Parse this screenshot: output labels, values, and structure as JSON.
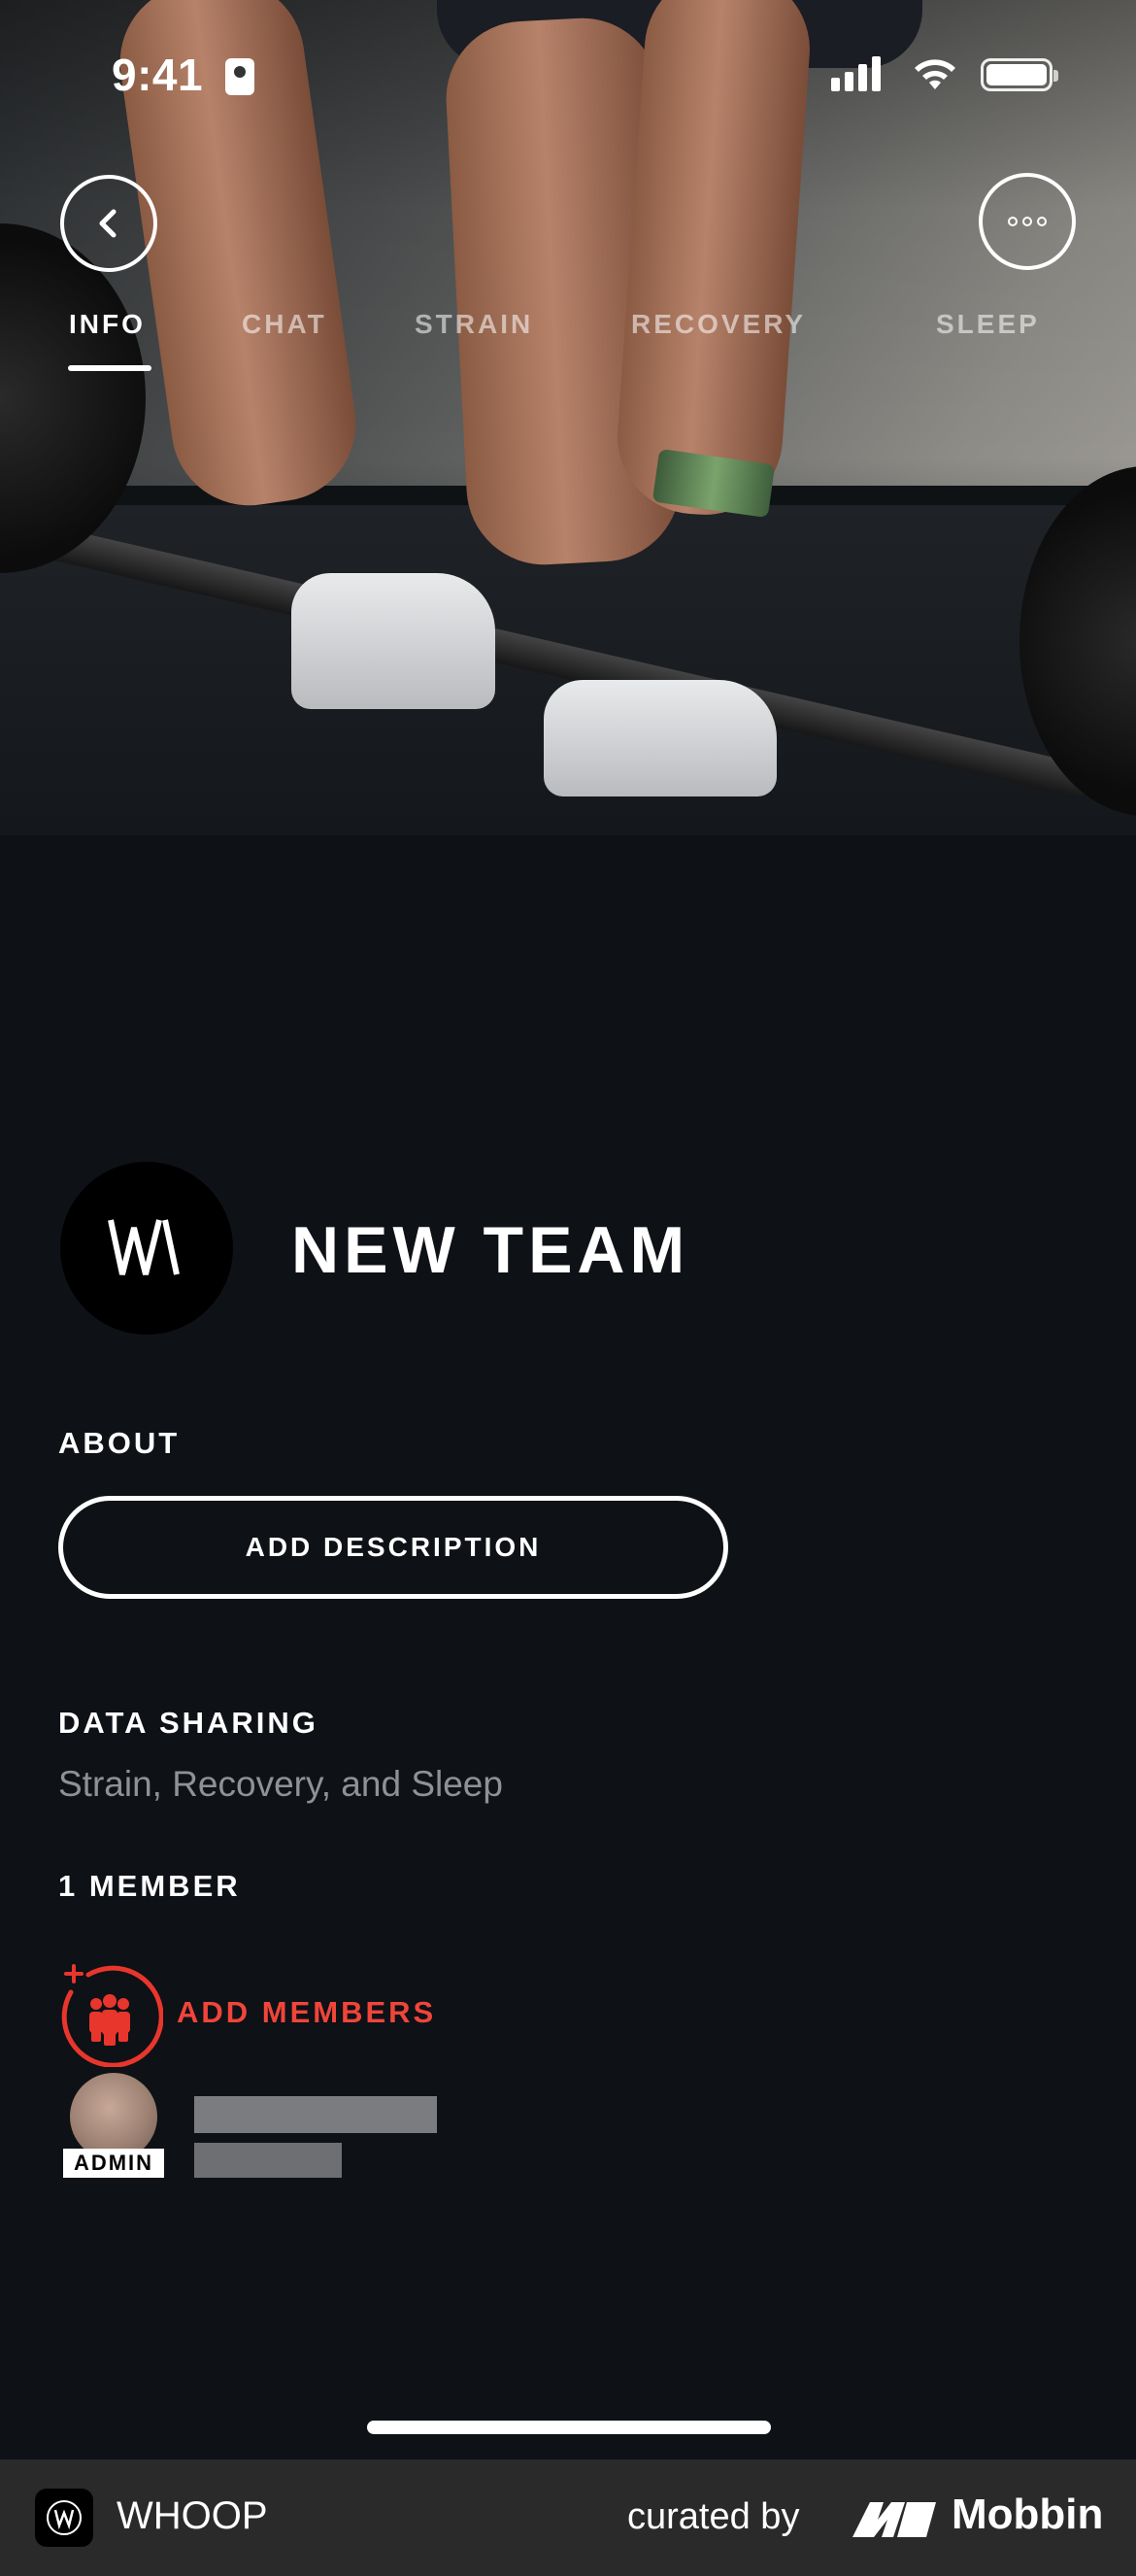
{
  "status_bar": {
    "time": "9:41"
  },
  "tabs": [
    {
      "label": "INFO",
      "active": true
    },
    {
      "label": "CHAT",
      "active": false
    },
    {
      "label": "STRAIN",
      "active": false
    },
    {
      "label": "RECOVERY",
      "active": false
    },
    {
      "label": "SLEEP",
      "active": false
    }
  ],
  "team": {
    "name": "NEW TEAM"
  },
  "about": {
    "label": "ABOUT",
    "button_label": "ADD DESCRIPTION"
  },
  "data_sharing": {
    "label": "DATA SHARING",
    "value": "Strain, Recovery, and Sleep"
  },
  "members": {
    "count_label": "1 MEMBER",
    "add_label": "ADD MEMBERS",
    "list": [
      {
        "role_badge": "ADMIN"
      }
    ]
  },
  "footer": {
    "app_name": "WHOOP",
    "curated_by": "curated by",
    "brand": "Mobbin"
  },
  "colors": {
    "background": "#0e1116",
    "accent_red": "#f0453a",
    "muted_text": "#8e9196"
  }
}
